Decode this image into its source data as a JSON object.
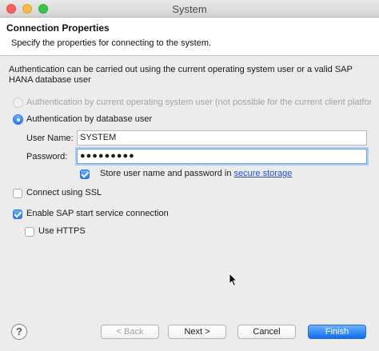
{
  "window": {
    "title": "System"
  },
  "banner": {
    "title": "Connection Properties",
    "description": "Specify the properties for connecting to the system."
  },
  "intro": {
    "line1": "Authentication can be carried out using the current operating system user or a valid SAP",
    "line2": "HANA database user"
  },
  "auth_options": {
    "os_user_label": "Authentication by current operating system user (not possible for the current client platform)",
    "db_user_label": "Authentication by database user"
  },
  "credentials": {
    "user_name_label": "User Name:",
    "user_name_value": "SYSTEM",
    "password_label": "Password:",
    "password_value": "●●●●●●●●●",
    "store_label": "Store user name and password in ",
    "store_link": "secure storage"
  },
  "options": {
    "ssl_label": "Connect using SSL",
    "sap_start_label": "Enable SAP start service connection",
    "https_label": "Use HTTPS"
  },
  "footer": {
    "help": "?",
    "back": "< Back",
    "next": "Next >",
    "cancel": "Cancel",
    "finish": "Finish"
  },
  "colors": {
    "accent": "#1d7cf2",
    "link": "#1f4fd8"
  }
}
